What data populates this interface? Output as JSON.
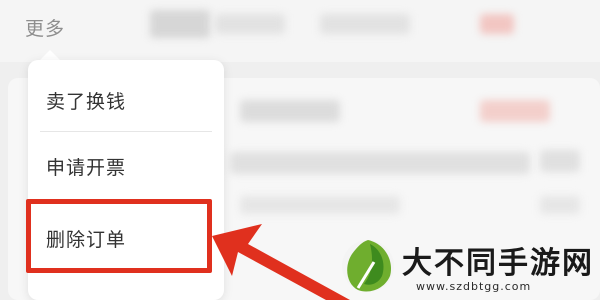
{
  "header": {
    "more_label": "更多"
  },
  "menu": {
    "items": [
      {
        "label": "卖了换钱"
      },
      {
        "label": "申请开票"
      },
      {
        "label": "删除订单"
      }
    ]
  },
  "annotation": {
    "highlight_color": "#e0301e"
  },
  "watermark": {
    "title": "大不同手游网",
    "url": "www.szdbtgg.com"
  }
}
